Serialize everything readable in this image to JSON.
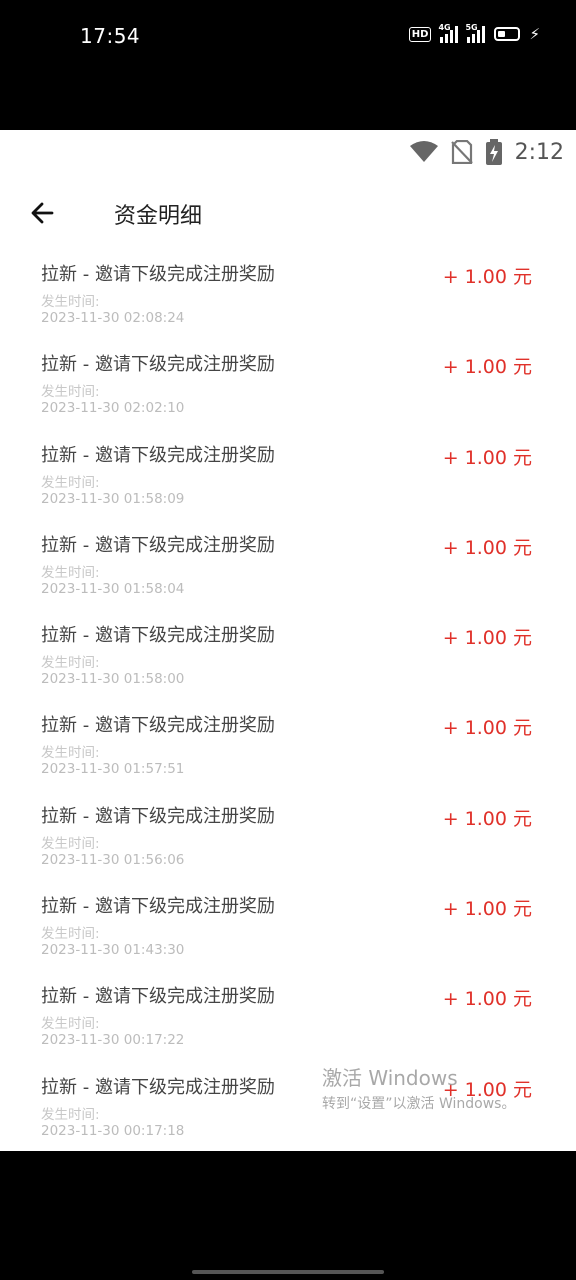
{
  "outer_status": {
    "time": "17:54",
    "hd_label": "HD",
    "network_1": "4G",
    "network_2": "5G",
    "icons": [
      "hd-icon",
      "signal-4g-icon",
      "signal-5g-icon",
      "battery-icon",
      "charging-bolt-icon"
    ]
  },
  "inner_status": {
    "time": "2:12",
    "icons": [
      "wifi-icon",
      "no-sim-icon",
      "battery-charging-icon"
    ]
  },
  "header": {
    "back_icon": "arrow-left-icon",
    "title": "资金明细"
  },
  "transactions": [
    {
      "title": "拉新 - 邀请下级完成注册奖励",
      "time_label": "发生时间:",
      "date": "2023-11-30 02:08:24",
      "amount": "+ 1.00 元"
    },
    {
      "title": "拉新 - 邀请下级完成注册奖励",
      "time_label": "发生时间:",
      "date": "2023-11-30 02:02:10",
      "amount": "+ 1.00 元"
    },
    {
      "title": "拉新 - 邀请下级完成注册奖励",
      "time_label": "发生时间:",
      "date": "2023-11-30 01:58:09",
      "amount": "+ 1.00 元"
    },
    {
      "title": "拉新 - 邀请下级完成注册奖励",
      "time_label": "发生时间:",
      "date": "2023-11-30 01:58:04",
      "amount": "+ 1.00 元"
    },
    {
      "title": "拉新 - 邀请下级完成注册奖励",
      "time_label": "发生时间:",
      "date": "2023-11-30 01:58:00",
      "amount": "+ 1.00 元"
    },
    {
      "title": "拉新 - 邀请下级完成注册奖励",
      "time_label": "发生时间:",
      "date": "2023-11-30 01:57:51",
      "amount": "+ 1.00 元"
    },
    {
      "title": "拉新 - 邀请下级完成注册奖励",
      "time_label": "发生时间:",
      "date": "2023-11-30 01:56:06",
      "amount": "+ 1.00 元"
    },
    {
      "title": "拉新 - 邀请下级完成注册奖励",
      "time_label": "发生时间:",
      "date": "2023-11-30 01:43:30",
      "amount": "+ 1.00 元"
    },
    {
      "title": "拉新 - 邀请下级完成注册奖励",
      "time_label": "发生时间:",
      "date": "2023-11-30 00:17:22",
      "amount": "+ 1.00 元"
    },
    {
      "title": "拉新 - 邀请下级完成注册奖励",
      "time_label": "发生时间:",
      "date": "2023-11-30 00:17:18",
      "amount": "+ 1.00 元"
    }
  ],
  "watermark": {
    "line1": "激活 Windows",
    "line2": "转到“设置”以激活 Windows。"
  },
  "colors": {
    "amount": "#e0312a",
    "title_text": "#444444",
    "muted_text": "#c8c8c8",
    "background": "#ffffff",
    "outer_bar": "#000000"
  }
}
